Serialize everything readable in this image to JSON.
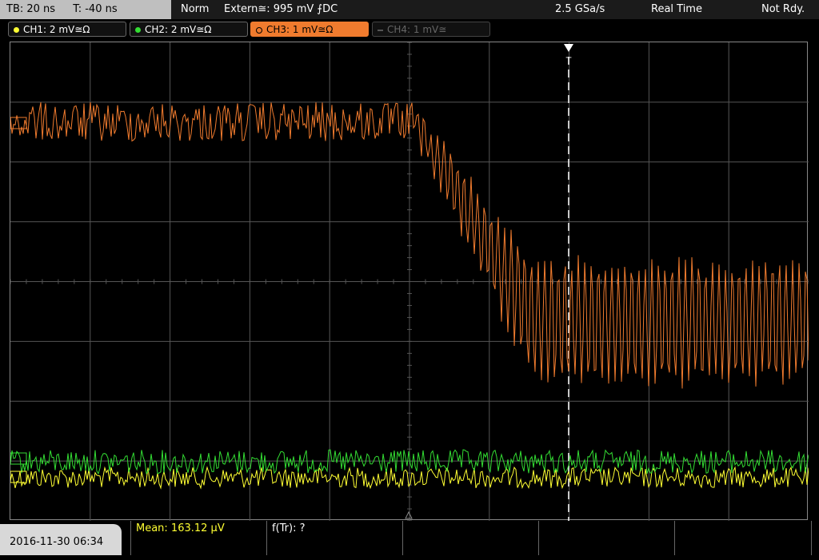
{
  "top": {
    "timebase": "TB: 20 ns",
    "trigger_time": "T: -40 ns",
    "mode": "Norm",
    "trigger_source": "Extern≅: 995 mV ⨍DC",
    "sample_rate": "2.5 GSa/s",
    "acq_mode": "Real Time",
    "status": "Not Rdy."
  },
  "channels": [
    {
      "label": "CH1: 2 mV≅Ω",
      "color": "#ffff33",
      "state": "on"
    },
    {
      "label": "CH2: 2 mV≅Ω",
      "color": "#33dd33",
      "state": "on"
    },
    {
      "label": "CH3: 1 mV≅Ω",
      "color": "#f07b2e",
      "state": "active"
    },
    {
      "label": "CH4: 1 mV≅",
      "color": "#555555",
      "state": "off"
    }
  ],
  "trigger_marker": "T",
  "bottom": {
    "datetime": "2016-11-30 06:34",
    "mean": "Mean: 163.12 µV",
    "ftr": "f(Tr): ?"
  },
  "colors": {
    "ch1": "#ffff33",
    "ch2": "#33dd33",
    "ch3": "#f07b2e",
    "grid": "#555555"
  }
}
